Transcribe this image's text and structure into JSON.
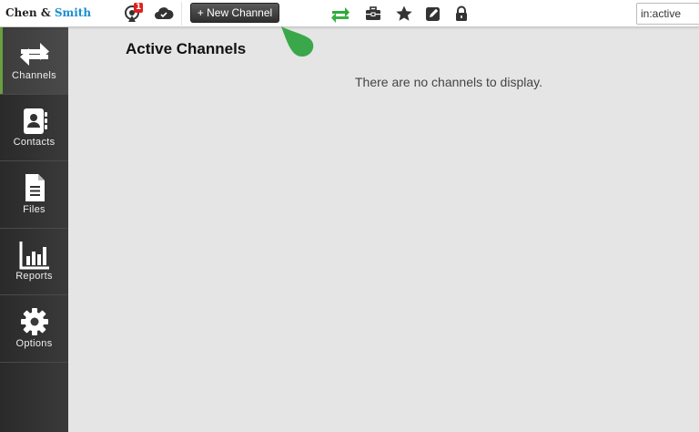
{
  "app": {
    "logo": {
      "part1": "Chen",
      "amp": "&",
      "part2": "Smith"
    }
  },
  "toolbar": {
    "notifications_badge": "1",
    "new_channel_label": "+ New Channel",
    "icons": [
      "notification-icon",
      "cloud-sync-icon",
      "transfer-arrows-icon",
      "toolbox-icon",
      "star-icon",
      "edit-icon",
      "lock-icon"
    ],
    "search_value": "in:active"
  },
  "sidebar": {
    "items": [
      {
        "label": "Channels",
        "icon": "arrows-icon",
        "active": true
      },
      {
        "label": "Contacts",
        "icon": "address-book-icon",
        "active": false
      },
      {
        "label": "Files",
        "icon": "file-icon",
        "active": false
      },
      {
        "label": "Reports",
        "icon": "bar-chart-icon",
        "active": false
      },
      {
        "label": "Options",
        "icon": "gear-icon",
        "active": false
      }
    ]
  },
  "main": {
    "title": "Active Channels",
    "empty_message": "There are no channels to display."
  },
  "colors": {
    "brand_blue": "#1a8fd0",
    "accent_green": "#2eab3a",
    "badge_red": "#e02020",
    "sidebar_bg": "#333333",
    "content_bg": "#e5e5e5"
  }
}
